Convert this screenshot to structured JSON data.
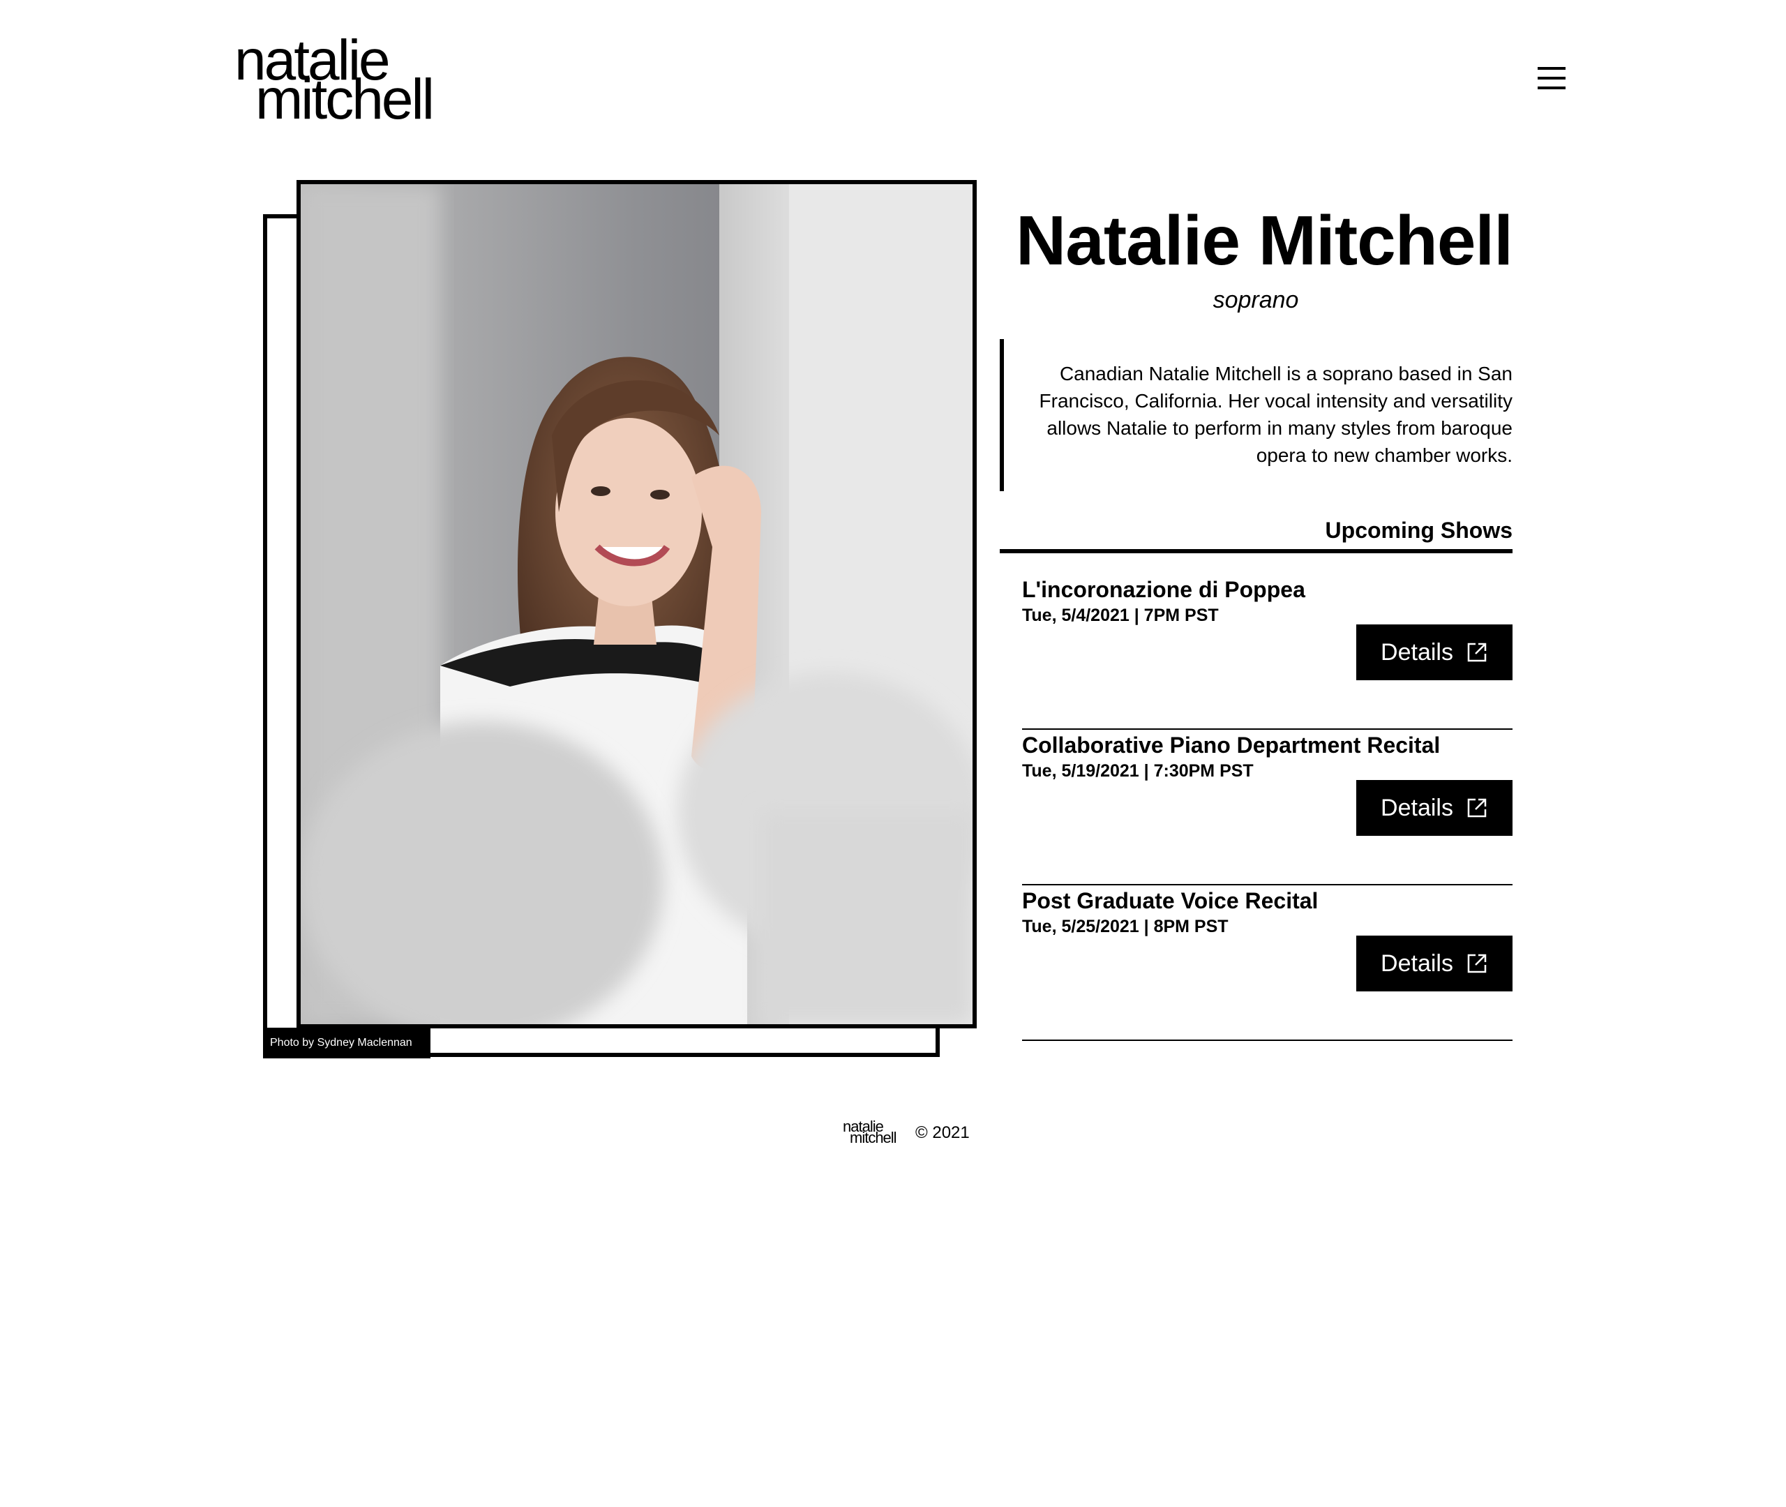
{
  "header": {
    "logo_line1": "natalie",
    "logo_line2": "mitchell",
    "menu_icon": "hamburger-menu-icon"
  },
  "photo": {
    "credit": "Photo by Sydney Maclennan",
    "alt": "Portrait of Natalie Mitchell"
  },
  "profile": {
    "name": "Natalie Mitchell",
    "voice_type": "soprano",
    "bio": "Canadian Natalie Mitchell is a soprano based in San Francisco, California. Her vocal intensity and versatility allows Natalie to perform in many styles from baroque opera to new chamber works."
  },
  "shows": {
    "heading": "Upcoming Shows",
    "items": [
      {
        "title": "L'incoronazione di Poppea",
        "date": "Tue, 5/4/2021 | 7PM PST",
        "button_label": "Details",
        "button_icon": "external-link-icon"
      },
      {
        "title": "Collaborative Piano Department Recital",
        "date": "Tue, 5/19/2021 | 7:30PM PST",
        "button_label": "Details",
        "button_icon": "external-link-icon"
      },
      {
        "title": "Post Graduate Voice Recital",
        "date": "Tue, 5/25/2021 | 8PM PST",
        "button_label": "Details",
        "button_icon": "external-link-icon"
      }
    ]
  },
  "footer": {
    "logo_line1": "natalie",
    "logo_line2": "mitchell",
    "copyright": "© 2021"
  },
  "colors": {
    "text": "#000000",
    "background": "#ffffff",
    "button_bg": "#000000",
    "button_text": "#ffffff"
  }
}
